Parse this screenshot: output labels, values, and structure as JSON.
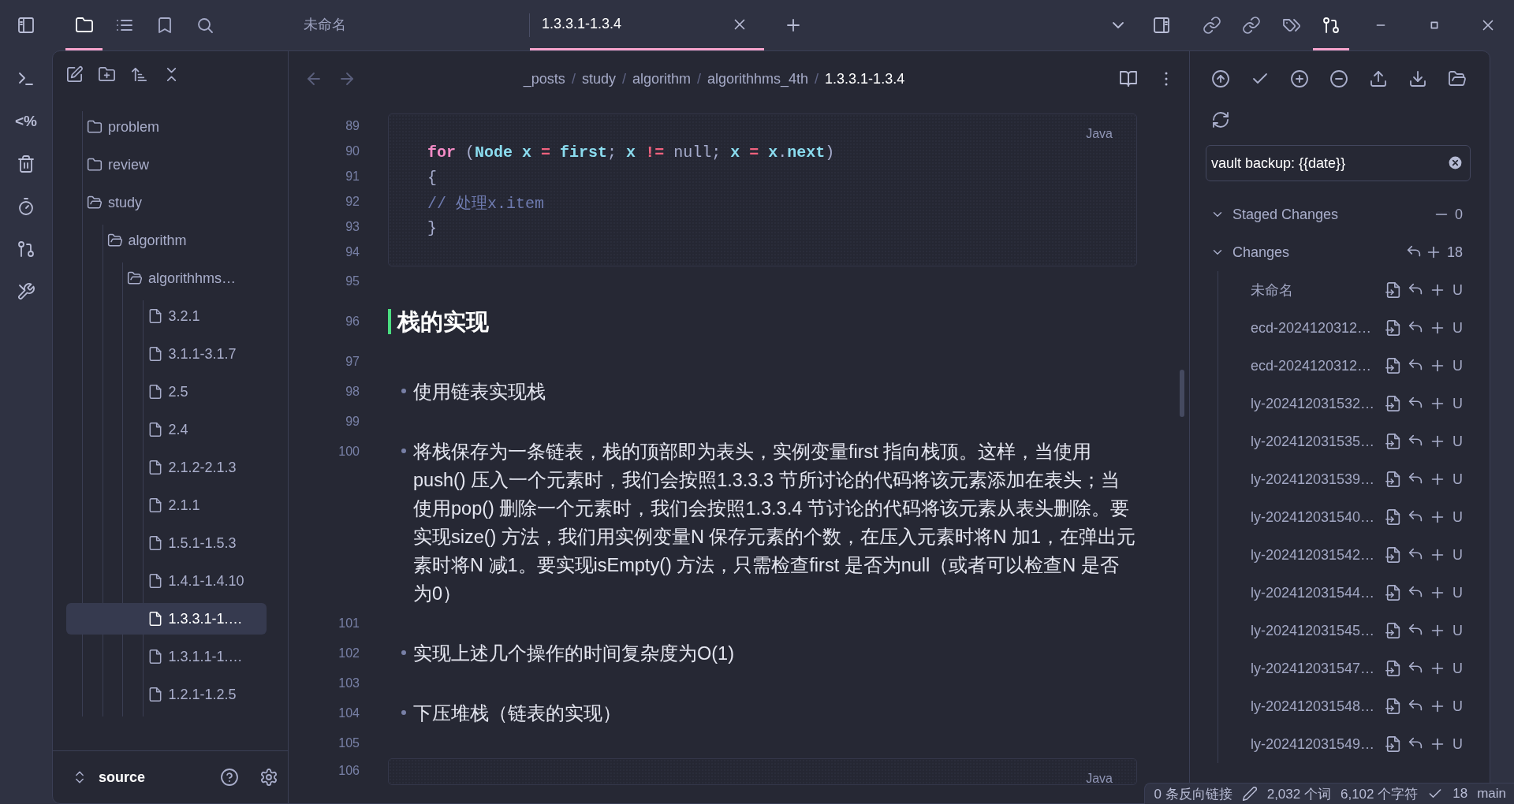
{
  "left_sidebar_tabs": [
    {
      "kind": "files",
      "selected": true
    },
    {
      "kind": "outline",
      "selected": false
    },
    {
      "kind": "bookmarks",
      "selected": false
    },
    {
      "kind": "search",
      "selected": false
    }
  ],
  "tabs": [
    {
      "title": "未命名",
      "selected": false
    },
    {
      "title": "1.3.3.1-1.3.4",
      "selected": true
    }
  ],
  "right_sidebar_tabs": [
    {
      "kind": "backlinks",
      "selected": false
    },
    {
      "kind": "outgoing_links",
      "selected": false
    },
    {
      "kind": "tags",
      "selected": false
    },
    {
      "kind": "source_control",
      "selected": true
    }
  ],
  "ribbon": [
    {
      "kind": "terminal"
    },
    {
      "kind": "text",
      "label": "<%"
    },
    {
      "kind": "trash"
    },
    {
      "kind": "timer"
    },
    {
      "kind": "git"
    },
    {
      "kind": "tools"
    }
  ],
  "explorer": {
    "tree": [
      {
        "name": "problem",
        "kind": "folder",
        "expanded": false
      },
      {
        "name": "review",
        "kind": "folder",
        "expanded": false
      },
      {
        "name": "study",
        "kind": "folder",
        "expanded": true,
        "children": [
          {
            "name": "algorithm",
            "kind": "folder",
            "expanded": true,
            "children": [
              {
                "name": "algorithhms…",
                "kind": "folder",
                "expanded": true,
                "children": [
                  {
                    "name": "3.2.1",
                    "kind": "file",
                    "selected": false
                  },
                  {
                    "name": "3.1.1-3.1.7",
                    "kind": "file",
                    "selected": false
                  },
                  {
                    "name": "2.5",
                    "kind": "file",
                    "selected": false
                  },
                  {
                    "name": "2.4",
                    "kind": "file",
                    "selected": false
                  },
                  {
                    "name": "2.1.2-2.1.3",
                    "kind": "file",
                    "selected": false
                  },
                  {
                    "name": "2.1.1",
                    "kind": "file",
                    "selected": false
                  },
                  {
                    "name": "1.5.1-1.5.3",
                    "kind": "file",
                    "selected": false
                  },
                  {
                    "name": "1.4.1-1.4.10",
                    "kind": "file",
                    "selected": false
                  },
                  {
                    "name": "1.3.3.1-1.…",
                    "kind": "file",
                    "selected": true
                  },
                  {
                    "name": "1.3.1.1-1.…",
                    "kind": "file",
                    "selected": false
                  },
                  {
                    "name": "1.2.1-1.2.5",
                    "kind": "file",
                    "selected": false
                  }
                ]
              }
            ]
          }
        ]
      }
    ],
    "vault": "source"
  },
  "editor": {
    "breadcrumb_separator": "/",
    "breadcrumb": [
      "_posts",
      "study",
      "algorithm",
      "algorithhms_4th",
      "1.3.3.1-1.3.4"
    ],
    "blocks": [
      {
        "kind": "code",
        "language": "Java",
        "lines": [
          {
            "number": "89"
          },
          {
            "number": "90",
            "tokens": [
              {
                "kind": "keyword",
                "text": "for"
              },
              {
                "kind": "plain",
                "text": " ("
              },
              {
                "kind": "type",
                "text": "Node"
              },
              {
                "kind": "ident",
                "text": " x"
              },
              {
                "kind": "op",
                "text": " ="
              },
              {
                "kind": "ident",
                "text": " first"
              },
              {
                "kind": "plain",
                "text": "; "
              },
              {
                "kind": "ident",
                "text": "x"
              },
              {
                "kind": "op",
                "text": " !="
              },
              {
                "kind": "plain",
                "text": " null; "
              },
              {
                "kind": "ident",
                "text": "x"
              },
              {
                "kind": "op",
                "text": " ="
              },
              {
                "kind": "ident",
                "text": " x"
              },
              {
                "kind": "plain",
                "text": "."
              },
              {
                "kind": "ident",
                "text": "next"
              },
              {
                "kind": "plain",
                "text": ")"
              }
            ]
          },
          {
            "number": "91",
            "tokens": [
              {
                "kind": "plain",
                "text": "{"
              }
            ]
          },
          {
            "number": "92",
            "tokens": [
              {
                "kind": "comment",
                "text": "// 处理x.item"
              }
            ]
          },
          {
            "number": "93",
            "tokens": [
              {
                "kind": "plain",
                "text": "}"
              }
            ]
          },
          {
            "number": "94"
          }
        ]
      },
      {
        "kind": "blank",
        "number": "95"
      },
      {
        "kind": "heading",
        "number": "96",
        "text": "栈的实现"
      },
      {
        "kind": "blank",
        "number": "97"
      },
      {
        "kind": "bullet",
        "number": "98",
        "text": "使用链表实现栈"
      },
      {
        "kind": "blank",
        "number": "99"
      },
      {
        "kind": "bullet",
        "number": "100",
        "text": "将栈保存为一条链表，栈的顶部即为表头，实例变量first 指向栈顶。这样，当使用push() 压入一个元素时，我们会按照1.3.3.3 节所讨论的代码将该元素添加在表头；当使用pop() 删除一个元素时，我们会按照1.3.3.4 节讨论的代码将该元素从表头删除。要实现size() 方法，我们用实例变量N 保存元素的个数，在压入元素时将N 加1，在弹出元素时将N 减1。要实现isEmpty() 方法，只需检查first 是否为null（或者可以检查N 是否为0）"
      },
      {
        "kind": "blank",
        "number": "101"
      },
      {
        "kind": "bullet",
        "number": "102",
        "text": "实现上述几个操作的时间复杂度为O(1)"
      },
      {
        "kind": "blank",
        "number": "103"
      },
      {
        "kind": "bullet",
        "number": "104",
        "text": "下压堆栈（链表的实现）"
      },
      {
        "kind": "blank",
        "number": "105"
      },
      {
        "kind": "code",
        "language": "Java",
        "lines": [
          {
            "number": "106"
          }
        ]
      }
    ]
  },
  "source_control": {
    "commit_message": "vault backup: {{date}}",
    "staged": {
      "label": "Staged Changes",
      "count": "0",
      "expanded": true
    },
    "changes": {
      "label": "Changes",
      "count": "18",
      "expanded": true,
      "files": [
        {
          "name": "未命名",
          "status": "U"
        },
        {
          "name": "ecd-2024120312…",
          "status": "U"
        },
        {
          "name": "ecd-2024120312…",
          "status": "U"
        },
        {
          "name": "ly-202412031532…",
          "status": "U"
        },
        {
          "name": "ly-202412031535…",
          "status": "U"
        },
        {
          "name": "ly-202412031539…",
          "status": "U"
        },
        {
          "name": "ly-202412031540…",
          "status": "U"
        },
        {
          "name": "ly-202412031542…",
          "status": "U"
        },
        {
          "name": "ly-202412031544…",
          "status": "U"
        },
        {
          "name": "ly-202412031545…",
          "status": "U"
        },
        {
          "name": "ly-202412031547…",
          "status": "U"
        },
        {
          "name": "ly-202412031548…",
          "status": "U"
        },
        {
          "name": "ly-202412031549…",
          "status": "U"
        }
      ]
    }
  },
  "status_bar": {
    "backlinks": "0 条反向链接",
    "words": "2,032 个词",
    "characters": "6,102 个字符",
    "changes": "18",
    "branch": "main"
  }
}
